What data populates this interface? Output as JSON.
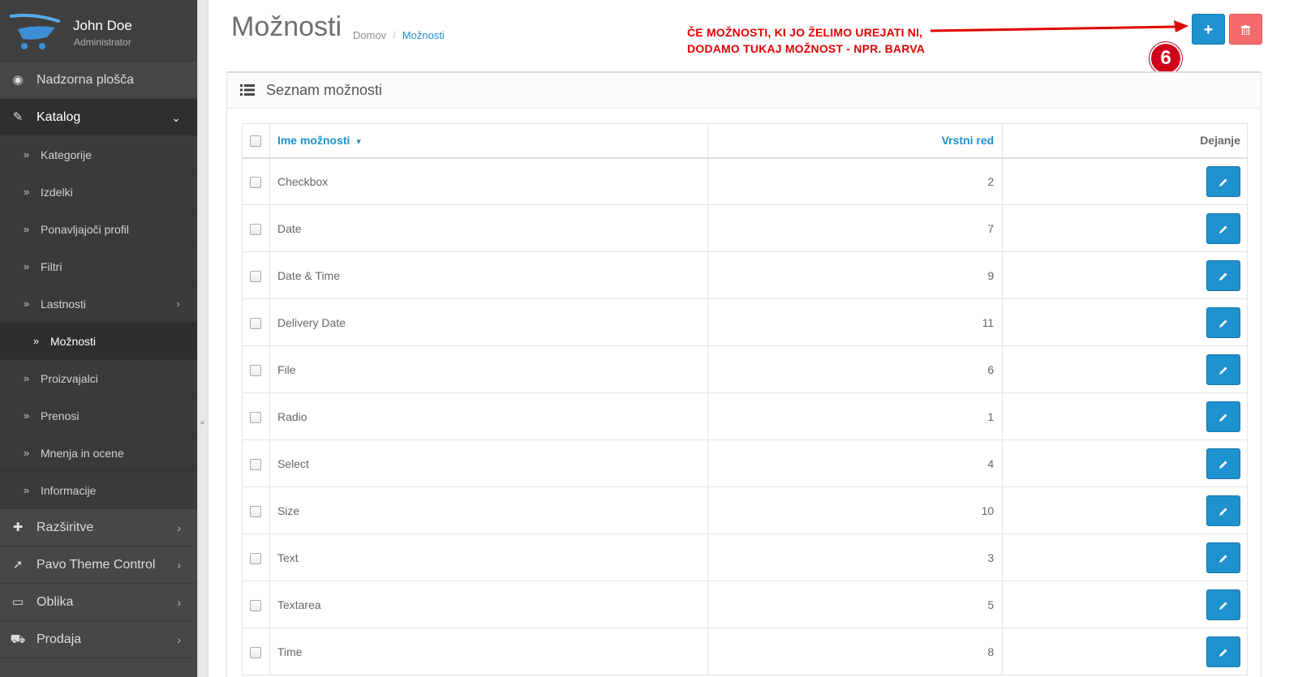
{
  "profile": {
    "name": "John Doe",
    "role": "Administrator"
  },
  "sidebar": {
    "items": [
      {
        "label": "Nadzorna plošča",
        "icon": "dashboard-icon"
      },
      {
        "label": "Katalog",
        "icon": "tags-icon",
        "expanded": true
      }
    ],
    "catalog_sub": [
      {
        "label": "Kategorije"
      },
      {
        "label": "Izdelki"
      },
      {
        "label": "Ponavljajoči profil"
      },
      {
        "label": "Filtri"
      },
      {
        "label": "Lastnosti",
        "has_children": true
      },
      {
        "label": "Možnosti",
        "current": true
      },
      {
        "label": "Proizvajalci"
      },
      {
        "label": "Prenosi"
      },
      {
        "label": "Mnenja in ocene"
      },
      {
        "label": "Informacije"
      }
    ],
    "bottom_items": [
      {
        "label": "Razširitve",
        "icon": "puzzle-icon"
      },
      {
        "label": "Pavo Theme Control",
        "icon": "rocket-icon"
      },
      {
        "label": "Oblika",
        "icon": "monitor-icon"
      },
      {
        "label": "Prodaja",
        "icon": "cart-icon"
      }
    ]
  },
  "header": {
    "title": "Možnosti",
    "breadcrumb": [
      "Domov",
      "Možnosti"
    ],
    "add_label": "+",
    "annotation_line1": "ČE MOŽNOSTI, KI JO ŽELIMO UREJATI NI,",
    "annotation_line2": "DODAMO TUKAJ MOŽNOST - NPR. BARVA",
    "step_number": "6"
  },
  "panel": {
    "title": "Seznam možnosti",
    "columns": {
      "name": "Ime možnosti",
      "order": "Vrstni red",
      "action": "Dejanje"
    },
    "rows": [
      {
        "name": "Checkbox",
        "order": "2"
      },
      {
        "name": "Date",
        "order": "7"
      },
      {
        "name": "Date & Time",
        "order": "9"
      },
      {
        "name": "Delivery Date",
        "order": "11"
      },
      {
        "name": "File",
        "order": "6"
      },
      {
        "name": "Radio",
        "order": "1"
      },
      {
        "name": "Select",
        "order": "4"
      },
      {
        "name": "Size",
        "order": "10"
      },
      {
        "name": "Text",
        "order": "3"
      },
      {
        "name": "Textarea",
        "order": "5"
      },
      {
        "name": "Time",
        "order": "8"
      }
    ]
  },
  "colors": {
    "primary": "#1e91cf",
    "danger": "#f56b6b",
    "sidebar": "#474747",
    "annotation": "#e10000"
  }
}
